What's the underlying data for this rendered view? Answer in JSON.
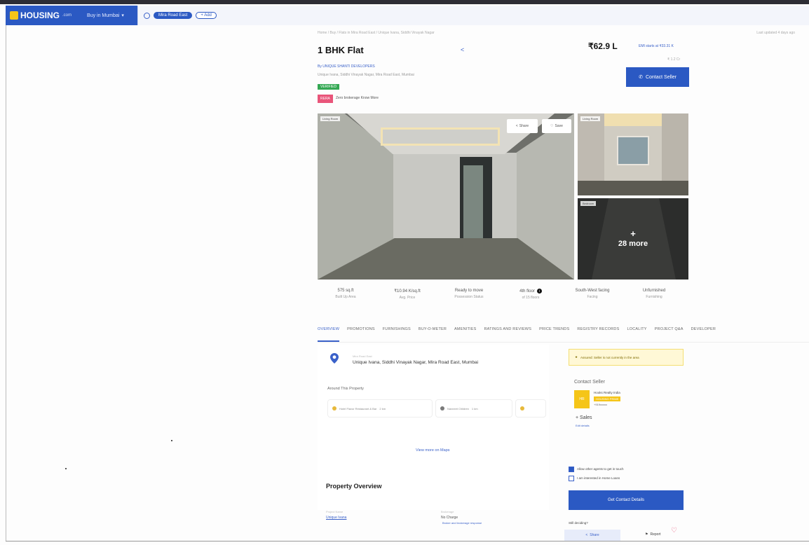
{
  "navbar": {
    "logo_text": "HOUSING",
    "logo_suffix": ".com",
    "city_selector": "Buy in Mumbai",
    "search_chip": "Mira Road East",
    "add_chip": "+ Add"
  },
  "listing": {
    "breadcrumb": "Home / Buy / Flats in Mira Road East / Unique Ivana, Siddhi Vinayak Nagar",
    "posted": "Last updated 4 days ago",
    "title": "1 BHK Flat",
    "price": "₹62.9 L",
    "emi": "EMI starts at ₹33.31 K",
    "price_sub": "₹ 1.2 Cr",
    "contact_button": "Contact Seller",
    "builder": "By UNIQUE SHANTI DEVELOPERS",
    "address_line": "Unique Ivana, Siddhi Vinayak Nagar, Mira Road East, Mumbai",
    "verified_badge": "VERIFIED",
    "red_badge": "RERA",
    "red_badge_text": "Zero brokerage Know More"
  },
  "gallery": {
    "main_tag": "Living Room",
    "share_label": "Share",
    "save_label": "Save",
    "thumb1_tag": "Living Room",
    "thumb2_tag": "Bedroom",
    "more_plus": "+",
    "more_label": "28 more"
  },
  "stats": [
    {
      "value": "575 sq.ft",
      "label": "Built Up Area"
    },
    {
      "value": "₹10.94 K/sq.ft",
      "label": "Avg. Price"
    },
    {
      "value": "Ready to move",
      "label": "Possession Status"
    },
    {
      "value": "4th floor",
      "label": "of 15 floors"
    },
    {
      "value": "South-West facing",
      "label": "Facing"
    },
    {
      "value": "Unfurnished",
      "label": "Furnishing"
    }
  ],
  "tabs": [
    "OVERVIEW",
    "PROMOTIONS",
    "FURNISHINGS",
    "BUY-O-METER",
    "AMENITIES",
    "RATINGS AND REVIEWS",
    "PRICE TRENDS",
    "REGISTRY RECORDS",
    "LOCALITY",
    "PROJECT Q&A",
    "DEVELOPER"
  ],
  "location": {
    "small_label": "Mira Road East",
    "address": "Unique Ivana, Siddhi Vinayak Nagar, Mira Road East, Mumbai",
    "around_title": "Around This Property",
    "around_items": [
      {
        "name": "Hotel Flavor Restaurant & Bar",
        "dist": "2 km"
      },
      {
        "name": "Navneet Children",
        "dist": "1 km"
      },
      {
        "name": "",
        "dist": ""
      }
    ],
    "view_more": "View more on Maps"
  },
  "overview": {
    "title": "Property Overview",
    "label1": "Project Name",
    "value1": "Unique Ivana",
    "label2": "Brokerage",
    "value2": "No Charge",
    "value2b": "Broker and brokerage response"
  },
  "sidebar": {
    "alert": "Assured: Seller is not currently in the area",
    "contact_title": "Contact Seller",
    "logo_text": "HR",
    "seller_name": "Hooks Realty India",
    "seller_badge": "HOUSING PRIME",
    "seller_id": "+919xxxxx",
    "seller_role": "+ Sales",
    "seller_link": "Edit details",
    "check1": "Allow other agents to get in touch",
    "check2": "I am interested in Home Loans",
    "get_contact": "Get Contact Details",
    "still_deciding": "Still deciding?"
  },
  "footer": {
    "share": "Share",
    "report": "Report"
  },
  "colors": {
    "brand_blue": "#2b59c3",
    "accent_yellow": "#f5c518",
    "pink": "#e9557a",
    "green": "#34a853"
  }
}
